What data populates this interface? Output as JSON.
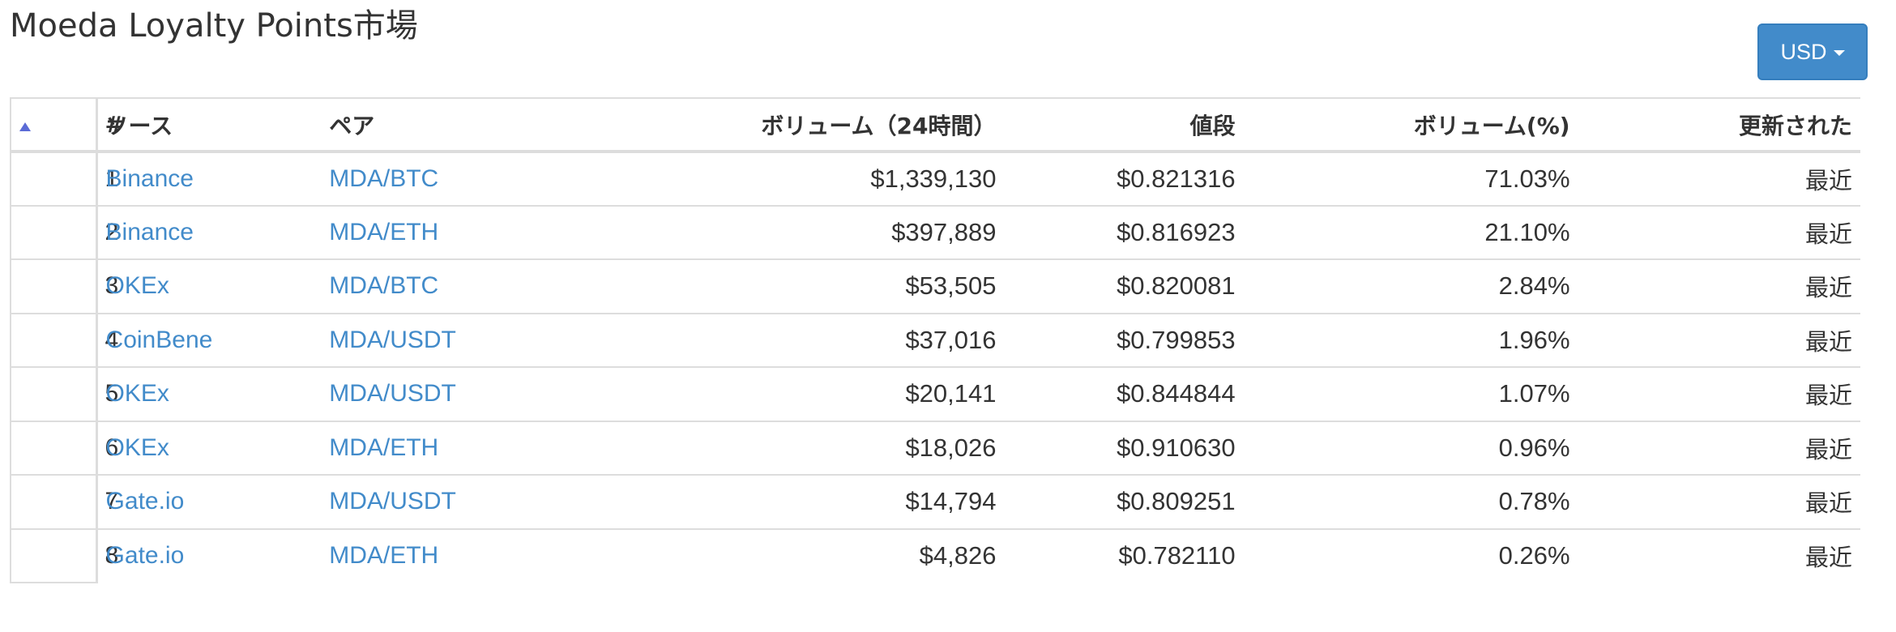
{
  "page": {
    "title": "Moeda Loyalty Points市場"
  },
  "currency_selector": {
    "label": "USD",
    "icon": "caret-down-icon"
  },
  "table": {
    "sort_icon": "sort-ascending-icon",
    "headers": {
      "num": "#",
      "source": "ソース",
      "pair": "ペア",
      "volume_24h": "ボリューム（24時間）",
      "price": "値段",
      "volume_pct": "ボリューム(%)",
      "updated": "更新された"
    },
    "rows": [
      {
        "num": "1",
        "source": "Binance",
        "pair": "MDA/BTC",
        "volume": "$1,339,130",
        "price": "$0.821316",
        "volume_pct": "71.03%",
        "updated": "最近"
      },
      {
        "num": "2",
        "source": "Binance",
        "pair": "MDA/ETH",
        "volume": "$397,889",
        "price": "$0.816923",
        "volume_pct": "21.10%",
        "updated": "最近"
      },
      {
        "num": "3",
        "source": "OKEx",
        "pair": "MDA/BTC",
        "volume": "$53,505",
        "price": "$0.820081",
        "volume_pct": "2.84%",
        "updated": "最近"
      },
      {
        "num": "4",
        "source": "CoinBene",
        "pair": "MDA/USDT",
        "volume": "$37,016",
        "price": "$0.799853",
        "volume_pct": "1.96%",
        "updated": "最近"
      },
      {
        "num": "5",
        "source": "OKEx",
        "pair": "MDA/USDT",
        "volume": "$20,141",
        "price": "$0.844844",
        "volume_pct": "1.07%",
        "updated": "最近"
      },
      {
        "num": "6",
        "source": "OKEx",
        "pair": "MDA/ETH",
        "volume": "$18,026",
        "price": "$0.910630",
        "volume_pct": "0.96%",
        "updated": "最近"
      },
      {
        "num": "7",
        "source": "Gate.io",
        "pair": "MDA/USDT",
        "volume": "$14,794",
        "price": "$0.809251",
        "volume_pct": "0.78%",
        "updated": "最近"
      },
      {
        "num": "8",
        "source": "Gate.io",
        "pair": "MDA/ETH",
        "volume": "$4,826",
        "price": "$0.782110",
        "volume_pct": "0.26%",
        "updated": "最近"
      }
    ]
  }
}
